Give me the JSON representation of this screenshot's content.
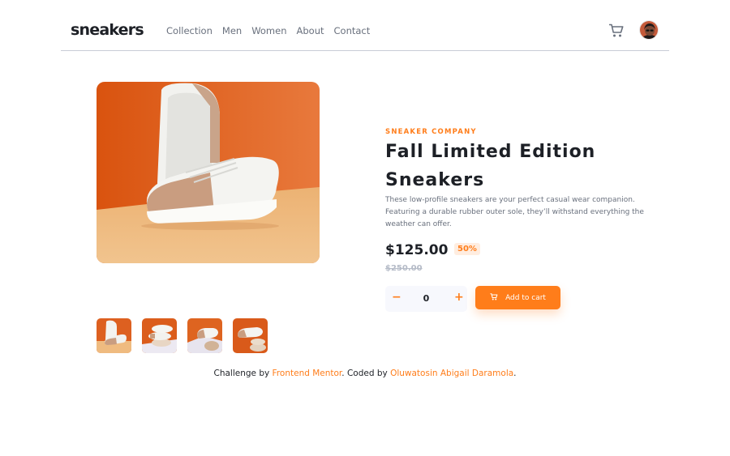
{
  "header": {
    "logo": "sneakers",
    "nav": [
      "Collection",
      "Men",
      "Women",
      "About",
      "Contact"
    ],
    "icons": {
      "cart": "cart-icon",
      "avatar": "avatar"
    }
  },
  "product": {
    "company": "SNEAKER COMPANY",
    "title": "Fall Limited Edition Sneakers",
    "description": "These low-profile sneakers are your perfect casual wear companion. Featuring a durable rubber outer sole, they’ll withstand everything the weather can offer.",
    "price": "$125.00",
    "discount": "50%",
    "old_price": "$250.00",
    "quantity": "0",
    "minus": "−",
    "plus": "+",
    "add_to_cart": "Add to cart"
  },
  "footer": {
    "challenge_by": "Challenge by",
    "link1": "Frontend Mentor",
    "coded_by": ". Coded by",
    "link2": "Oluwatosin Abigail Daramola",
    "end": "."
  },
  "colors": {
    "accent": "#ff7d1a",
    "accent_pale": "#ffede0",
    "text_dark": "#1d2026",
    "text_grey": "#69707d"
  }
}
